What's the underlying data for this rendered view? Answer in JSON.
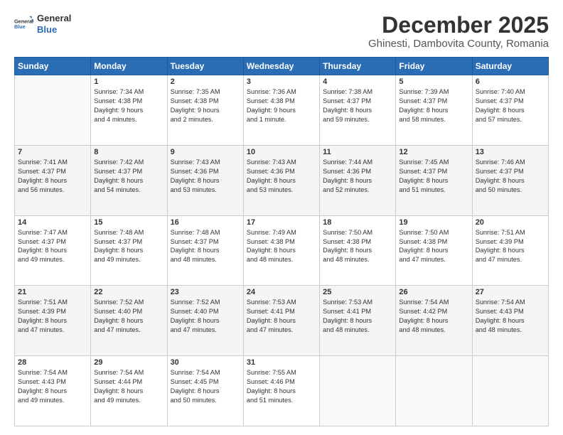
{
  "logo": {
    "text1": "General",
    "text2": "Blue"
  },
  "header": {
    "title": "December 2025",
    "subtitle": "Ghinesti, Dambovita County, Romania"
  },
  "weekdays": [
    "Sunday",
    "Monday",
    "Tuesday",
    "Wednesday",
    "Thursday",
    "Friday",
    "Saturday"
  ],
  "weeks": [
    [
      {
        "day": "",
        "info": ""
      },
      {
        "day": "1",
        "info": "Sunrise: 7:34 AM\nSunset: 4:38 PM\nDaylight: 9 hours\nand 4 minutes."
      },
      {
        "day": "2",
        "info": "Sunrise: 7:35 AM\nSunset: 4:38 PM\nDaylight: 9 hours\nand 2 minutes."
      },
      {
        "day": "3",
        "info": "Sunrise: 7:36 AM\nSunset: 4:38 PM\nDaylight: 9 hours\nand 1 minute."
      },
      {
        "day": "4",
        "info": "Sunrise: 7:38 AM\nSunset: 4:37 PM\nDaylight: 8 hours\nand 59 minutes."
      },
      {
        "day": "5",
        "info": "Sunrise: 7:39 AM\nSunset: 4:37 PM\nDaylight: 8 hours\nand 58 minutes."
      },
      {
        "day": "6",
        "info": "Sunrise: 7:40 AM\nSunset: 4:37 PM\nDaylight: 8 hours\nand 57 minutes."
      }
    ],
    [
      {
        "day": "7",
        "info": "Sunrise: 7:41 AM\nSunset: 4:37 PM\nDaylight: 8 hours\nand 56 minutes."
      },
      {
        "day": "8",
        "info": "Sunrise: 7:42 AM\nSunset: 4:37 PM\nDaylight: 8 hours\nand 54 minutes."
      },
      {
        "day": "9",
        "info": "Sunrise: 7:43 AM\nSunset: 4:36 PM\nDaylight: 8 hours\nand 53 minutes."
      },
      {
        "day": "10",
        "info": "Sunrise: 7:43 AM\nSunset: 4:36 PM\nDaylight: 8 hours\nand 53 minutes."
      },
      {
        "day": "11",
        "info": "Sunrise: 7:44 AM\nSunset: 4:36 PM\nDaylight: 8 hours\nand 52 minutes."
      },
      {
        "day": "12",
        "info": "Sunrise: 7:45 AM\nSunset: 4:37 PM\nDaylight: 8 hours\nand 51 minutes."
      },
      {
        "day": "13",
        "info": "Sunrise: 7:46 AM\nSunset: 4:37 PM\nDaylight: 8 hours\nand 50 minutes."
      }
    ],
    [
      {
        "day": "14",
        "info": "Sunrise: 7:47 AM\nSunset: 4:37 PM\nDaylight: 8 hours\nand 49 minutes."
      },
      {
        "day": "15",
        "info": "Sunrise: 7:48 AM\nSunset: 4:37 PM\nDaylight: 8 hours\nand 49 minutes."
      },
      {
        "day": "16",
        "info": "Sunrise: 7:48 AM\nSunset: 4:37 PM\nDaylight: 8 hours\nand 48 minutes."
      },
      {
        "day": "17",
        "info": "Sunrise: 7:49 AM\nSunset: 4:38 PM\nDaylight: 8 hours\nand 48 minutes."
      },
      {
        "day": "18",
        "info": "Sunrise: 7:50 AM\nSunset: 4:38 PM\nDaylight: 8 hours\nand 48 minutes."
      },
      {
        "day": "19",
        "info": "Sunrise: 7:50 AM\nSunset: 4:38 PM\nDaylight: 8 hours\nand 47 minutes."
      },
      {
        "day": "20",
        "info": "Sunrise: 7:51 AM\nSunset: 4:39 PM\nDaylight: 8 hours\nand 47 minutes."
      }
    ],
    [
      {
        "day": "21",
        "info": "Sunrise: 7:51 AM\nSunset: 4:39 PM\nDaylight: 8 hours\nand 47 minutes."
      },
      {
        "day": "22",
        "info": "Sunrise: 7:52 AM\nSunset: 4:40 PM\nDaylight: 8 hours\nand 47 minutes."
      },
      {
        "day": "23",
        "info": "Sunrise: 7:52 AM\nSunset: 4:40 PM\nDaylight: 8 hours\nand 47 minutes."
      },
      {
        "day": "24",
        "info": "Sunrise: 7:53 AM\nSunset: 4:41 PM\nDaylight: 8 hours\nand 47 minutes."
      },
      {
        "day": "25",
        "info": "Sunrise: 7:53 AM\nSunset: 4:41 PM\nDaylight: 8 hours\nand 48 minutes."
      },
      {
        "day": "26",
        "info": "Sunrise: 7:54 AM\nSunset: 4:42 PM\nDaylight: 8 hours\nand 48 minutes."
      },
      {
        "day": "27",
        "info": "Sunrise: 7:54 AM\nSunset: 4:43 PM\nDaylight: 8 hours\nand 48 minutes."
      }
    ],
    [
      {
        "day": "28",
        "info": "Sunrise: 7:54 AM\nSunset: 4:43 PM\nDaylight: 8 hours\nand 49 minutes."
      },
      {
        "day": "29",
        "info": "Sunrise: 7:54 AM\nSunset: 4:44 PM\nDaylight: 8 hours\nand 49 minutes."
      },
      {
        "day": "30",
        "info": "Sunrise: 7:54 AM\nSunset: 4:45 PM\nDaylight: 8 hours\nand 50 minutes."
      },
      {
        "day": "31",
        "info": "Sunrise: 7:55 AM\nSunset: 4:46 PM\nDaylight: 8 hours\nand 51 minutes."
      },
      {
        "day": "",
        "info": ""
      },
      {
        "day": "",
        "info": ""
      },
      {
        "day": "",
        "info": ""
      }
    ]
  ]
}
